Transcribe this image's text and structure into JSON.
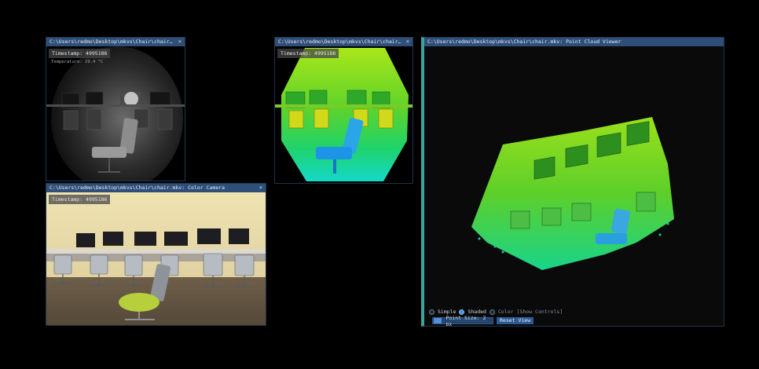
{
  "windows": {
    "infrared": {
      "title": "C:\\Users\\redmo\\Desktop\\mkvs\\Chair\\chair.mkv: Infrared Camera",
      "timestamp_label": "Timestamp: 4995186",
      "sub_text": "Temperature: 29.4 °C"
    },
    "depth": {
      "title": "C:\\Users\\redmo\\Desktop\\mkvs\\Chair\\chair.mkv: Depth Camera",
      "timestamp_label": "Timestamp: 4995186"
    },
    "color": {
      "title": "C:\\Users\\redmo\\Desktop\\mkvs\\Chair\\chair.mkv: Color Camera",
      "timestamp_label": "Timestamp: 4995186"
    },
    "pointcloud": {
      "title": "C:\\Users\\redmo\\Desktop\\mkvs\\Chair\\chair.mkv: Point Cloud Viewer",
      "controls": {
        "mode_options": [
          "Simple",
          "Shaded",
          "Color"
        ],
        "selected_mode": "Shaded",
        "show_controls_label": "[Show Controls]",
        "point_size_label": "Point Size: 2 px",
        "reset_view_label": "Reset View"
      }
    }
  },
  "colors": {
    "titlebar": "#2f4f78",
    "accent": "#4b8fe0",
    "divider": "#3aa39a"
  },
  "icons": {
    "close": "close-icon",
    "radio": "radio-icon"
  }
}
